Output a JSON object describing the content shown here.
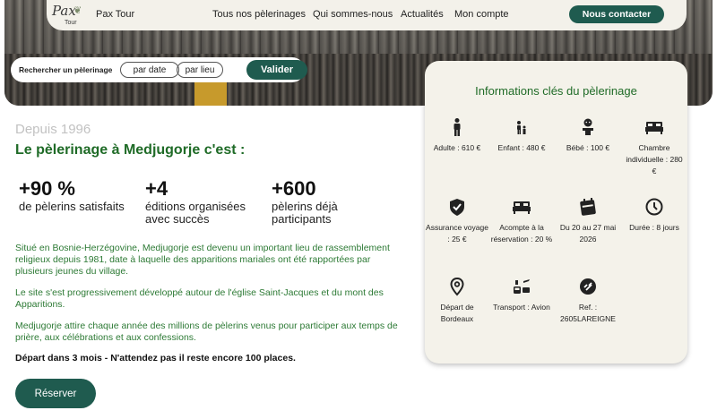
{
  "header": {
    "logo_script": "Pax",
    "logo_small": "Tour",
    "brand": "Pax Tour",
    "nav": [
      "Tous nos pèlerinages",
      "Qui sommes-nous",
      "Actualités",
      "Mon compte"
    ],
    "contact_label": "Nous contacter"
  },
  "search": {
    "label": "Rechercher un pèlerinage",
    "by_date": "par date",
    "by_place": "par lieu",
    "submit": "Valider"
  },
  "intro": {
    "since": "Depuis 1996",
    "title": "Le pèlerinage à Medjugorje c'est :"
  },
  "stats": [
    {
      "number": "+90 %",
      "text": "de pèlerins satisfaits"
    },
    {
      "number": "+4",
      "text": "éditions organisées avec succès"
    },
    {
      "number": "+600",
      "text": "pèlerins déjà participants"
    }
  ],
  "paragraphs": [
    "Situé en Bosnie-Herzégovine, Medjugorje est devenu un important lieu de rassemblement religieux depuis 1981, date à laquelle des apparitions mariales ont été rapportées par plusieurs jeunes du village.",
    "Le site s'est progressivement développé autour de l'église Saint-Jacques et du mont des Apparitions.",
    "Medjugorje attire chaque année des millions de pèlerins venus pour participer aux temps de prière, aux célébrations et aux confessions."
  ],
  "departure_note": "Départ dans 3 mois - N'attendez pas il reste encore 100 places.",
  "reserve_label": "Réserver",
  "info_card": {
    "title": "Informations clés du pèlerinage",
    "items": [
      {
        "icon": "adult-icon",
        "label": "Adulte : 610 €"
      },
      {
        "icon": "child-icon",
        "label": "Enfant : 480 €"
      },
      {
        "icon": "baby-icon",
        "label": "Bébé : 100 €"
      },
      {
        "icon": "bed-icon",
        "label": "Chambre individuelle : 280 €"
      },
      {
        "icon": "shield-icon",
        "label": "Assurance voyage : 25 €"
      },
      {
        "icon": "bed-icon",
        "label": "Acompte à la réservation : 20 %"
      },
      {
        "icon": "calendar-icon",
        "label": "Du 20 au 27 mai 2026"
      },
      {
        "icon": "clock-icon",
        "label": "Durée : 8 jours"
      },
      {
        "icon": "location-pin-icon",
        "label": "Départ de Bordeaux"
      },
      {
        "icon": "transport-icon",
        "label": "Transport : Avion"
      },
      {
        "icon": "reference-icon",
        "label": "Ref. : 2605LAREIGNE"
      }
    ]
  },
  "colors": {
    "accent": "#1f5b4f",
    "title_green": "#1f6b27",
    "text_green": "#2d7a35",
    "card_bg": "#f4f2ea"
  }
}
